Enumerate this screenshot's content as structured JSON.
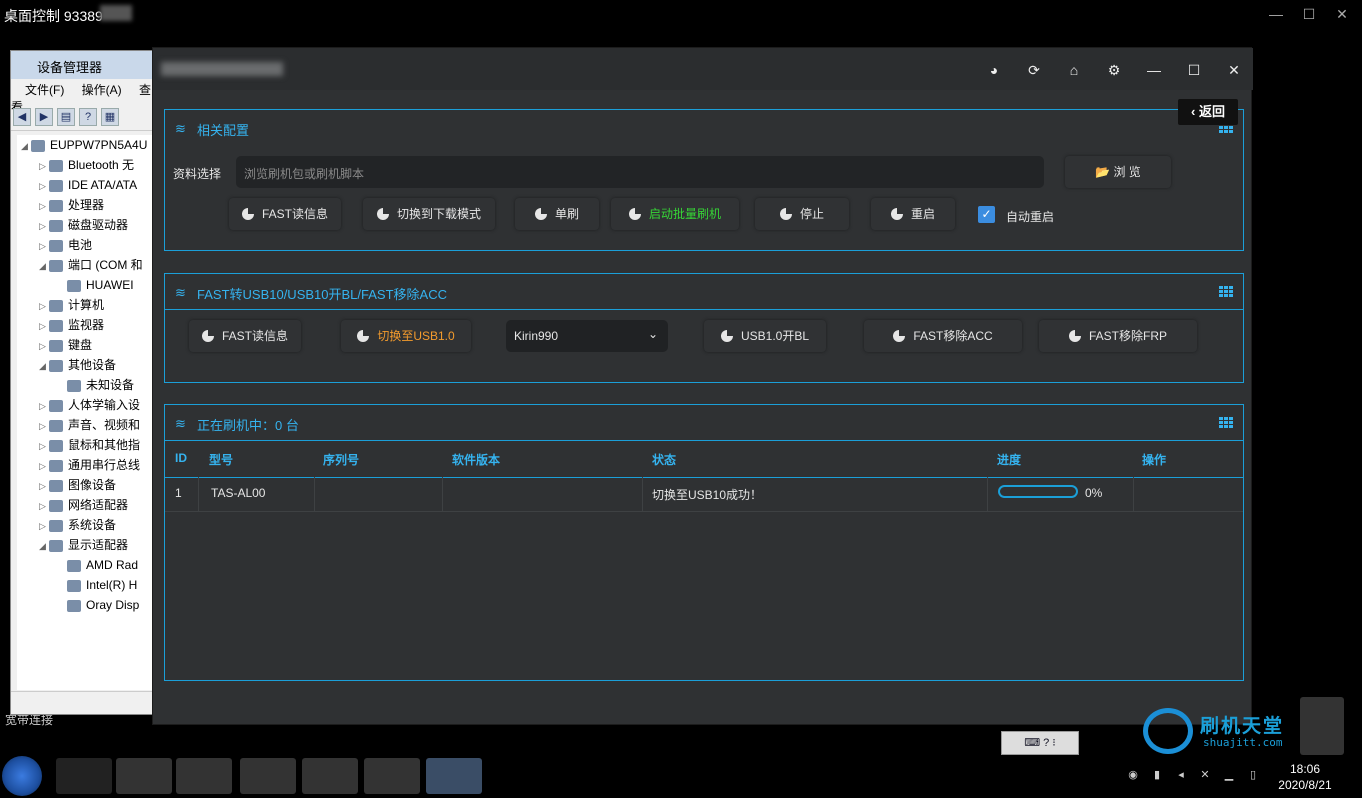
{
  "remote": {
    "title": "桌面控制 93389",
    "btn_min": "—",
    "btn_max": "☐",
    "btn_close": "✕",
    "drop": "⌄"
  },
  "devmgr": {
    "title": "设备管理器",
    "menu": [
      "文件(F)",
      "操作(A)",
      "查看"
    ],
    "tree": [
      {
        "label": "EUPPW7PN5A4U",
        "indent": 0,
        "arrow": "◢"
      },
      {
        "label": "Bluetooth 无",
        "indent": 1,
        "arrow": "▷"
      },
      {
        "label": "IDE ATA/ATA",
        "indent": 1,
        "arrow": "▷"
      },
      {
        "label": "处理器",
        "indent": 1,
        "arrow": "▷"
      },
      {
        "label": "磁盘驱动器",
        "indent": 1,
        "arrow": "▷"
      },
      {
        "label": "电池",
        "indent": 1,
        "arrow": "▷"
      },
      {
        "label": "端口 (COM 和",
        "indent": 1,
        "arrow": "◢"
      },
      {
        "label": "HUAWEI",
        "indent": 2,
        "arrow": ""
      },
      {
        "label": "计算机",
        "indent": 1,
        "arrow": "▷"
      },
      {
        "label": "监视器",
        "indent": 1,
        "arrow": "▷"
      },
      {
        "label": "键盘",
        "indent": 1,
        "arrow": "▷"
      },
      {
        "label": "其他设备",
        "indent": 1,
        "arrow": "◢"
      },
      {
        "label": "未知设备",
        "indent": 2,
        "arrow": ""
      },
      {
        "label": "人体学输入设",
        "indent": 1,
        "arrow": "▷"
      },
      {
        "label": "声音、视频和",
        "indent": 1,
        "arrow": "▷"
      },
      {
        "label": "鼠标和其他指",
        "indent": 1,
        "arrow": "▷"
      },
      {
        "label": "通用串行总线",
        "indent": 1,
        "arrow": "▷"
      },
      {
        "label": "图像设备",
        "indent": 1,
        "arrow": "▷"
      },
      {
        "label": "网络适配器",
        "indent": 1,
        "arrow": "▷"
      },
      {
        "label": "系统设备",
        "indent": 1,
        "arrow": "▷"
      },
      {
        "label": "显示适配器",
        "indent": 1,
        "arrow": "◢"
      },
      {
        "label": "AMD Rad",
        "indent": 2,
        "arrow": ""
      },
      {
        "label": "Intel(R) H",
        "indent": 2,
        "arrow": ""
      },
      {
        "label": "Oray Disp",
        "indent": 2,
        "arrow": ""
      }
    ]
  },
  "app": {
    "back_label": "返回",
    "back_icon": "‹",
    "icons": {
      "gauge": "◕",
      "refresh": "⟳",
      "home": "⌂",
      "settings": "⚙",
      "min": "—",
      "max": "☐",
      "close": "✕"
    },
    "panel1": {
      "title": "相关配置",
      "file_label": "资料选择",
      "file_placeholder": "浏览刷机包或刷机脚本",
      "browse_label": "浏 览",
      "buttons": [
        "FAST读信息",
        "切换到下载模式",
        "单刷",
        "启动批量刷机",
        "停止",
        "重启"
      ],
      "auto_restart_label": "自动重启",
      "auto_restart_checked": true
    },
    "panel2": {
      "title": "FAST转USB10/USB10开BL/FAST移除ACC",
      "buttons": [
        "FAST读信息",
        "切换至USB1.0",
        "USB1.0开BL",
        "FAST移除ACC",
        "FAST移除FRP"
      ],
      "chip_selected": "Kirin990"
    },
    "panel3": {
      "title": "正在刷机中：0 台",
      "columns": [
        "ID",
        "型号",
        "序列号",
        "软件版本",
        "状态",
        "进度",
        "操作"
      ],
      "rows": [
        {
          "id": "1",
          "model": "TAS-AL00",
          "serial": "",
          "version": "",
          "status": "切换至USB10成功！",
          "progress": 0,
          "progress_text": "0%",
          "action": ""
        }
      ]
    },
    "colors": {
      "accent": "#1b9fd8",
      "orange": "#f39b2d",
      "green": "#36d636"
    }
  },
  "watermark": {
    "name": "刷机天堂",
    "url": "shuajitt.com"
  },
  "desktop": {
    "icon_text": "宽带连接"
  },
  "taskbar": {
    "time": "18:06",
    "date": "2020/8/21"
  }
}
